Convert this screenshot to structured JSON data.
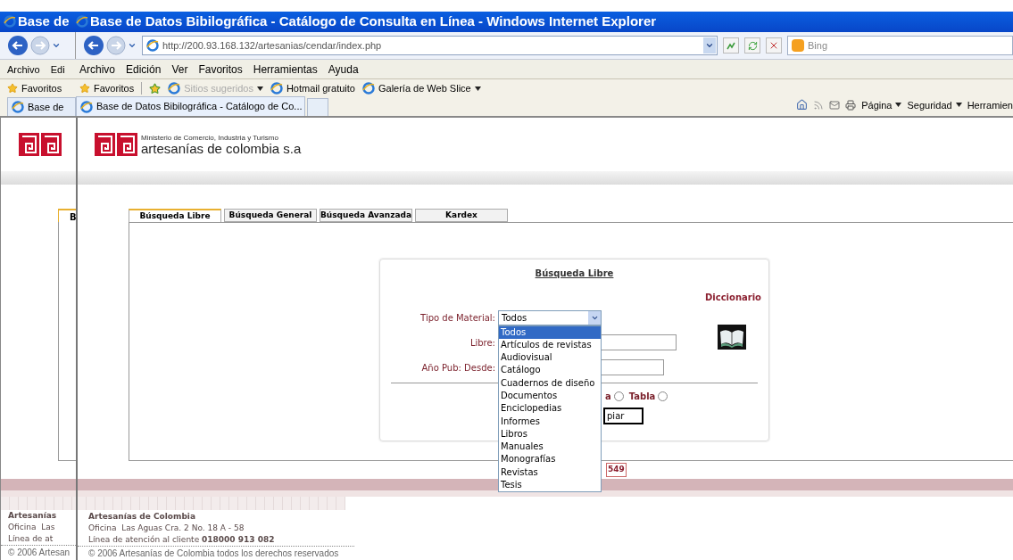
{
  "background_window": {
    "title": "Base de",
    "menu": [
      "Archivo",
      "Edi"
    ],
    "favorites": "Favoritos",
    "tab": "Base de",
    "page_tab": "B",
    "footer": {
      "name": "Artesanías",
      "office": "Oficina  Las",
      "line": "Línea de at",
      "copyright": "© 2006 Artesan"
    }
  },
  "window": {
    "title": "Base de Datos Bibilográfica - Catálogo de Consulta en Línea - Windows Internet Explorer"
  },
  "address_bar": {
    "url": "http://200.93.168.132/artesanias/cendar/index.php"
  },
  "search": {
    "placeholder": "Bing"
  },
  "menu": [
    "Archivo",
    "Edición",
    "Ver",
    "Favoritos",
    "Herramientas",
    "Ayuda"
  ],
  "favorites_bar": [
    {
      "label": "Favoritos",
      "kind": "favorites",
      "dropdown": false,
      "disabled": false
    },
    {
      "label": "Sitios sugeridos",
      "kind": "link",
      "dropdown": true,
      "disabled": true
    },
    {
      "label": "Hotmail gratuito",
      "kind": "link",
      "dropdown": false,
      "disabled": false
    },
    {
      "label": "Galería de Web Slice",
      "kind": "link",
      "dropdown": true,
      "disabled": false
    }
  ],
  "browser_tabs": [
    {
      "label": "Base de Datos Bibilográfica - Catálogo de Co...",
      "selected": true
    }
  ],
  "command_bar": [
    {
      "label": "Página",
      "dropdown": true
    },
    {
      "label": "Seguridad",
      "dropdown": true
    },
    {
      "label": "Herramien",
      "dropdown": false
    }
  ],
  "site": {
    "ministry": "Ministerio de Comercio, Industria y Turismo",
    "brand": "artesanías de colombia s.a"
  },
  "search_tabs": [
    {
      "label": "Búsqueda Libre",
      "selected": true
    },
    {
      "label": "Búsqueda General",
      "selected": false
    },
    {
      "label": "Búsqueda Avanzada",
      "selected": false
    },
    {
      "label": "Kardex",
      "selected": false
    }
  ],
  "form": {
    "title": "Búsqueda Libre",
    "dictionary_link": "Diccionario",
    "fields": [
      {
        "label": "Tipo de Material:",
        "kind": "select",
        "value": "Todos"
      },
      {
        "label": "Libre:",
        "kind": "text"
      },
      {
        "label": "Año Pub: Desde:",
        "kind": "text"
      }
    ],
    "dropdown_options": [
      {
        "label": "Todos",
        "selected": true
      },
      {
        "label": "Artículos de revistas",
        "selected": false
      },
      {
        "label": "Audiovisual",
        "selected": false
      },
      {
        "label": "Catálogo",
        "selected": false
      },
      {
        "label": "Cuadernos de diseño",
        "selected": false
      },
      {
        "label": "Documentos",
        "selected": false
      },
      {
        "label": "Enciclopedias",
        "selected": false
      },
      {
        "label": "Informes",
        "selected": false
      },
      {
        "label": "Libros",
        "selected": false
      },
      {
        "label": "Manuales",
        "selected": false
      },
      {
        "label": "Monografías",
        "selected": false
      },
      {
        "label": "Revistas",
        "selected": false
      },
      {
        "label": "Tesis",
        "selected": false
      }
    ],
    "radios": [
      {
        "label": "a",
        "selected": false
      },
      {
        "label": "Tabla",
        "selected": false
      }
    ],
    "button": "piar"
  },
  "counter": "549",
  "footer": {
    "name": "Artesanías de Colombia",
    "office": "Oficina  Las Aguas Cra. 2 No. 18 A - 58",
    "line": "Línea de atención al cliente **018000 913 082**",
    "copyright": "© 2006 Artesanías de Colombia todos los derechos reservados"
  }
}
